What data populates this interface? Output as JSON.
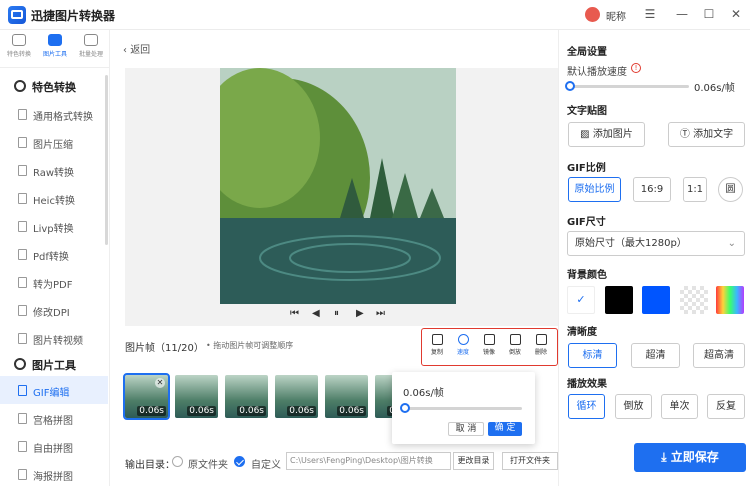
{
  "app": {
    "title": "迅捷图片转换器",
    "nickname": "昵称",
    "min": "—",
    "menu": "☰",
    "max": "☐",
    "close": "✕"
  },
  "topnav": [
    {
      "label": "特色转换"
    },
    {
      "label": "图片工具"
    },
    {
      "label": "批量处理"
    }
  ],
  "sidebar": {
    "section1": "特色转换",
    "items1": [
      "通用格式转换",
      "图片压缩",
      "Raw转换",
      "Heic转换",
      "Livp转换",
      "Pdf转换",
      "转为PDF",
      "修改DPI",
      "图片转视频"
    ],
    "section2": "图片工具",
    "items2": [
      "GIF编辑",
      "宫格拼图",
      "自由拼图",
      "海报拼图"
    ]
  },
  "main": {
    "back_label": "返回",
    "controls": {
      "first": "⏮",
      "prev": "◀",
      "pause": "⏸",
      "next": "▶",
      "last": "⏭"
    },
    "frames_label": "图片帧（11/20）",
    "frames_hint": "•  拖动图片帧可调整顺序",
    "tools": [
      {
        "label": "复制",
        "icon": "copy-icon"
      },
      {
        "label": "速度",
        "icon": "speed-icon"
      },
      {
        "label": "镜像",
        "icon": "mirror-icon"
      },
      {
        "label": "倒放",
        "icon": "reverse-icon"
      },
      {
        "label": "删除",
        "icon": "trash-icon"
      }
    ],
    "thumb_time": "0.06s",
    "speed_popup": {
      "value": "0.06s/帧",
      "cancel": "取 消",
      "confirm": "确 定",
      "level": 0.0
    },
    "output": {
      "label": "输出目录：",
      "original": "原文件夹",
      "custom": "自定义",
      "path": "C:\\Users\\FengPing\\Desktop\\图片转换",
      "change": "更改目录",
      "open": "打开文件夹"
    }
  },
  "right": {
    "global": "全局设置",
    "default_speed": "默认播放速度",
    "speed_value": "0.06s/帧",
    "sticker": "文字贴图",
    "add_image": "添加图片",
    "add_text": "添加文字",
    "ratio": "GIF比例",
    "ratios": [
      "原始比例",
      "16:9",
      "1:1",
      "圆"
    ],
    "size": "GIF尺寸",
    "size_value": "原始尺寸（最大1280p）",
    "bg": "背景颜色",
    "bg_colors": [
      "#ffffff",
      "#000000",
      "#0055ff"
    ],
    "clarity": "清晰度",
    "clarity_opts": [
      "标清",
      "超清",
      "超高清"
    ],
    "effect": "播放效果",
    "effects": [
      "循环",
      "倒放",
      "单次",
      "反复"
    ],
    "save": "立即保存"
  }
}
